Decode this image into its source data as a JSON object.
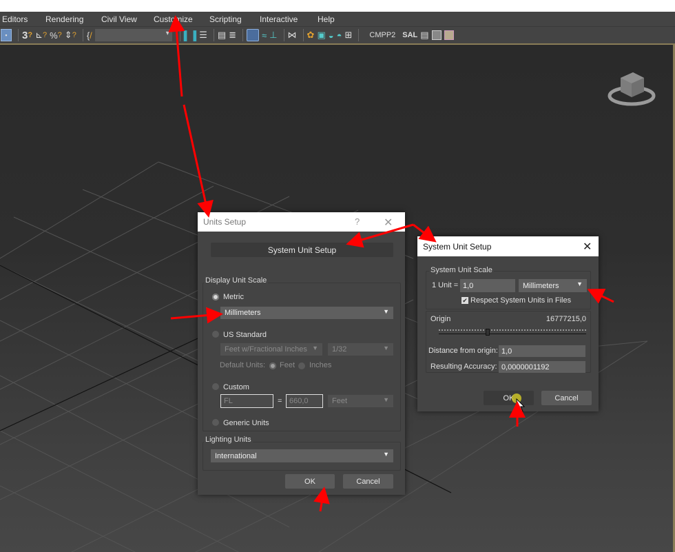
{
  "menubar": {
    "items": [
      "Editors",
      "Rendering",
      "Civil View",
      "Customize",
      "Scripting",
      "Interactive",
      "Help"
    ]
  },
  "toolbar": {
    "snap_labels": [
      "3",
      "%"
    ],
    "named_selection_placeholder": "",
    "text_items": [
      "CMPP2",
      "SAL"
    ]
  },
  "units_setup": {
    "title": "Units Setup",
    "help_glyph": "?",
    "close_glyph": "✕",
    "system_unit_setup_button": "System Unit Setup",
    "display_unit_scale_label": "Display Unit Scale",
    "metric_label": "Metric",
    "metric_selected": true,
    "metric_unit": "Millimeters",
    "us_standard_label": "US Standard",
    "us_standard_unit": "Feet w/Fractional Inches",
    "us_standard_fraction": "1/32",
    "default_units_label": "Default Units:",
    "default_units_feet": "Feet",
    "default_units_inches": "Inches",
    "custom_label": "Custom",
    "custom_name": "FL",
    "custom_equals": "=",
    "custom_value": "660,0",
    "custom_unit": "Feet",
    "generic_units_label": "Generic Units",
    "lighting_units_label": "Lighting Units",
    "lighting_units_value": "International",
    "ok_label": "OK",
    "cancel_label": "Cancel"
  },
  "system_unit_setup": {
    "title": "System Unit Setup",
    "close_glyph": "✕",
    "scale_group_label": "System Unit Scale",
    "one_unit_label": "1 Unit =",
    "unit_value": "1,0",
    "unit_type": "Millimeters",
    "respect_checkbox_label": "Respect System Units in Files",
    "respect_checked": true,
    "origin_label": "Origin",
    "origin_value": "16777215,0",
    "origin_slider_fraction": 0.33,
    "distance_label": "Distance from origin:",
    "distance_value": "1,0",
    "accuracy_label": "Resulting Accuracy:",
    "accuracy_value": "0,0000001192",
    "ok_label": "OK",
    "cancel_label": "Cancel"
  },
  "annotation": {
    "arrow_color": "#ff0000",
    "active_viewport_border": "#8a7d57"
  }
}
